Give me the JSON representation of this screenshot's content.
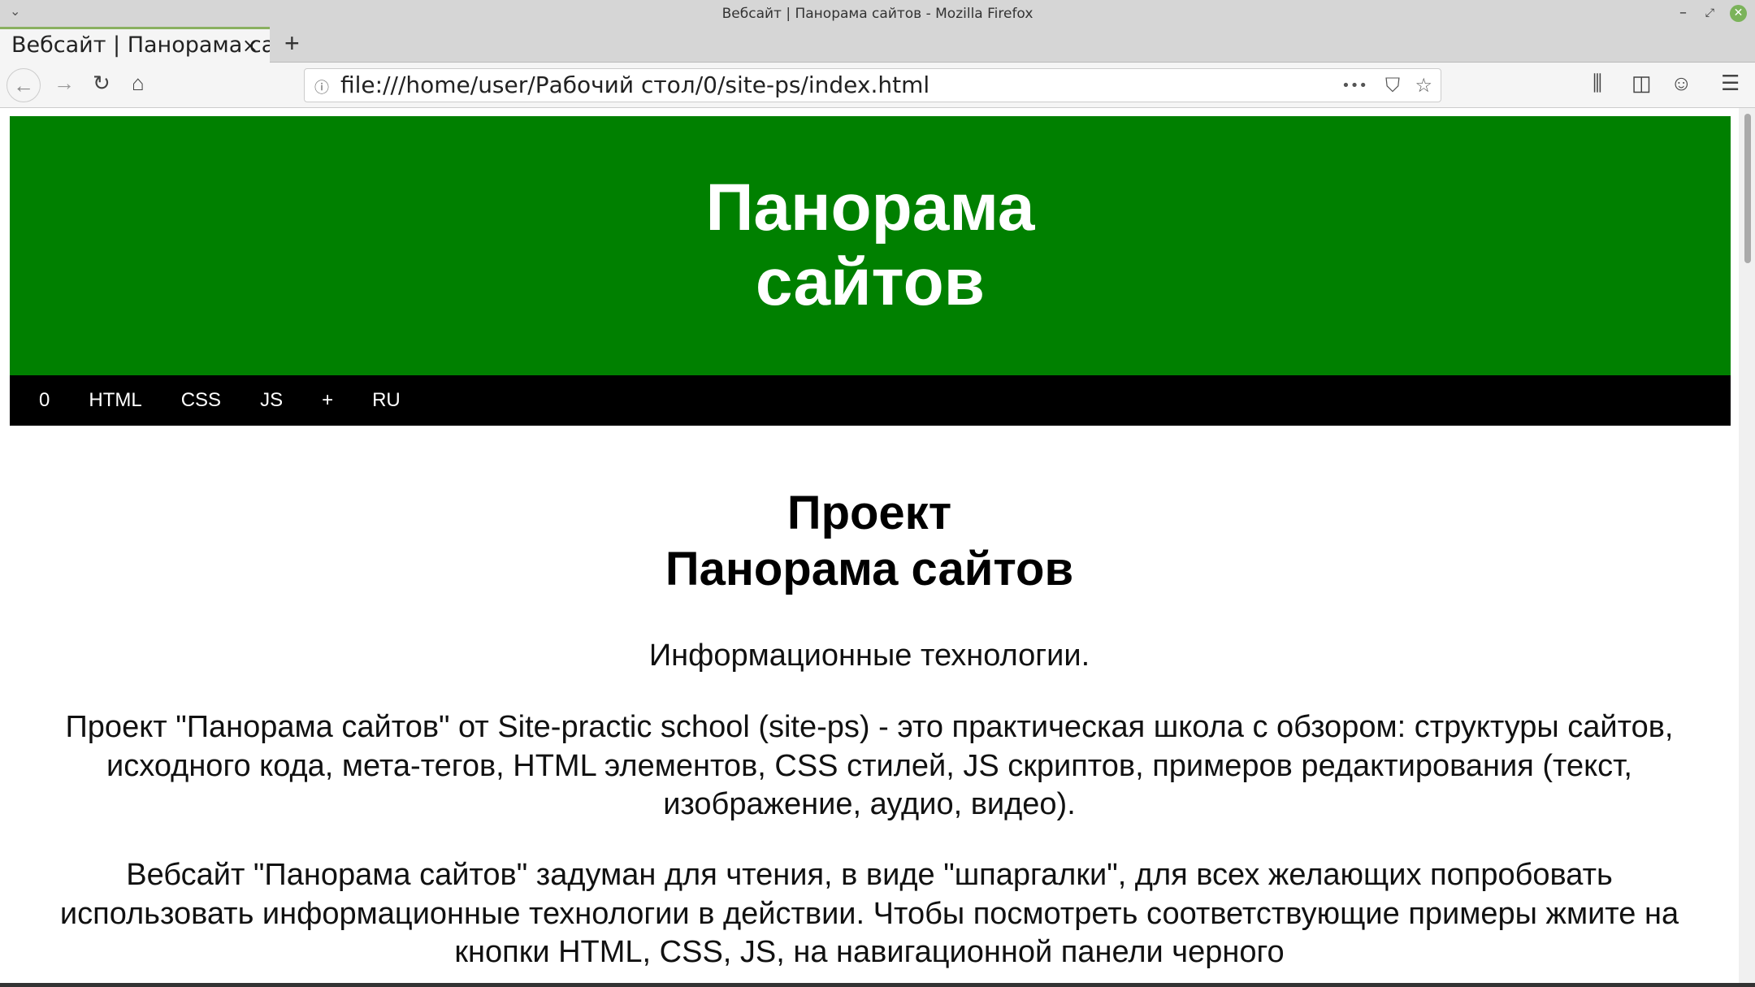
{
  "window": {
    "title": "Вебсайт | Панорама сайтов - Mozilla Firefox"
  },
  "tab": {
    "label": "Вебсайт | Панорама сайтов",
    "close": "×",
    "new_tab": "+"
  },
  "toolbar": {
    "url": "file:///home/user/Рабочий стол/0/site-ps/index.html",
    "more": "•••"
  },
  "header": {
    "title_line1": "Панорама",
    "title_line2": "сайтов"
  },
  "nav": {
    "items": [
      "0",
      "HTML",
      "CSS",
      "JS",
      "+",
      "RU"
    ]
  },
  "main": {
    "heading_line1": "Проект",
    "heading_line2": "Панорама сайтов",
    "subtitle": "Информационные технологии.",
    "paragraph1": "Проект \"Панорама сайтов\" от Site-practic school (site-ps) - это практическая школа с обзором: структуры сайтов, исходного кода, мета-тегов, HTML элементов, CSS стилей, JS скриптов, примеров редактирования (текст, изображение, аудио, видео).",
    "paragraph2": "Вебсайт \"Панорама сайтов\" задуман для чтения, в виде \"шпаргалки\", для всех желающих попробовать использовать информационные технологии в действии. Чтобы посмотреть соответствующие примеры жмите на кнопки HTML, CSS, JS, на навигационной панели черного"
  },
  "colors": {
    "header": "#008000",
    "nav": "#000000"
  }
}
